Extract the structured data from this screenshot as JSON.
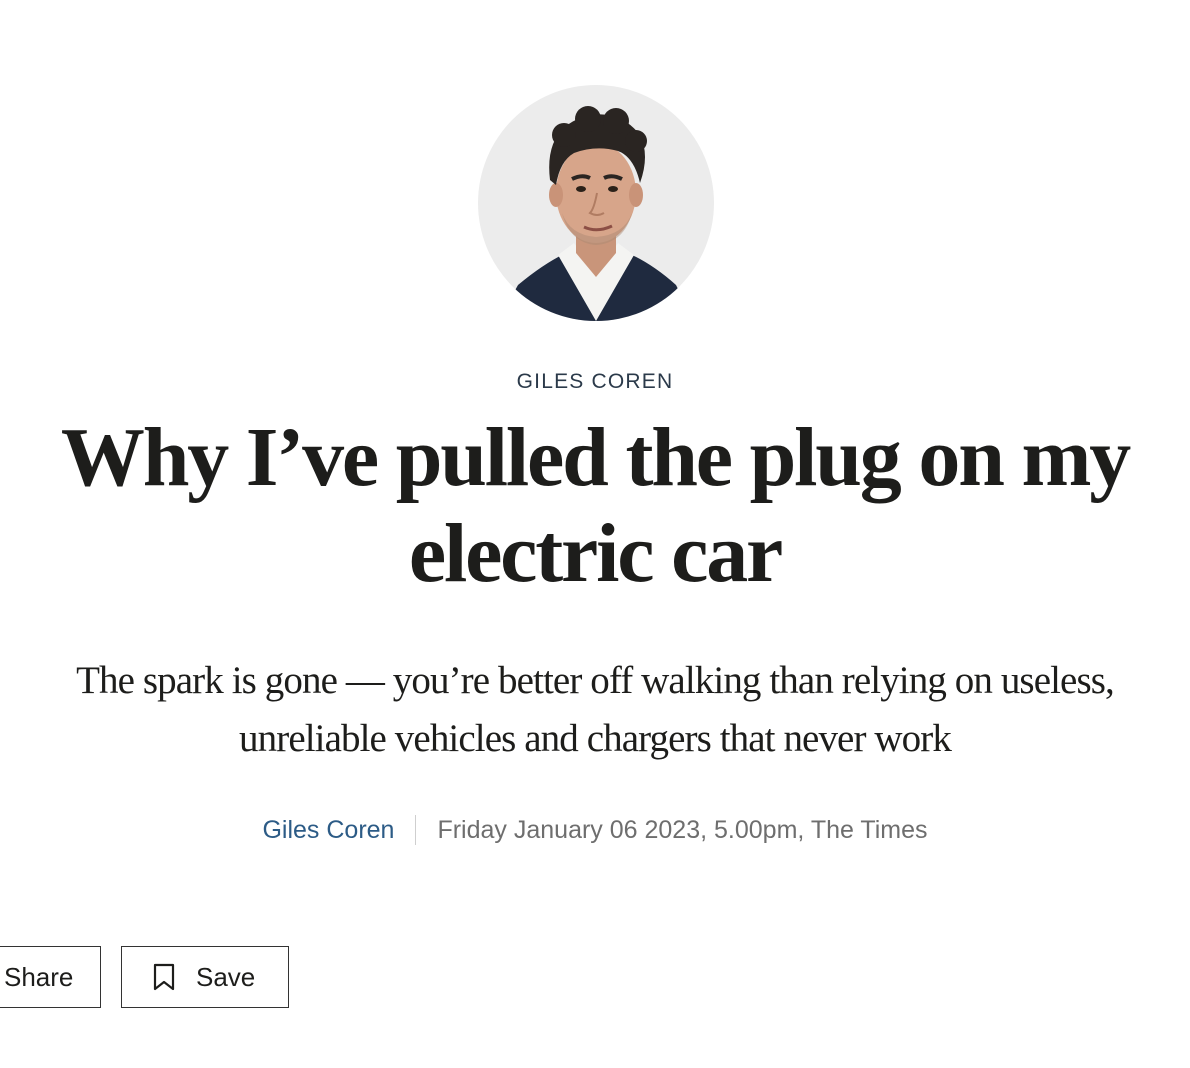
{
  "author": {
    "tag": "GILES COREN",
    "avatar_alt": "avatar"
  },
  "article": {
    "headline": "Why I’ve pulled the plug on my electric car",
    "standfirst": "The spark is gone — you’re better off walking than relying on useless, unreliable vehicles and chargers that never work"
  },
  "byline": {
    "author_name": "Giles Coren",
    "date_source": "Friday January 06 2023, 5.00pm, The Times"
  },
  "actions": {
    "share_label": "Share",
    "save_label": "Save",
    "save_icon": "bookmark-icon"
  },
  "colors": {
    "byline_link": "#2c5b86",
    "avatar_bg": "#ececec",
    "text": "#1d1d1b"
  }
}
